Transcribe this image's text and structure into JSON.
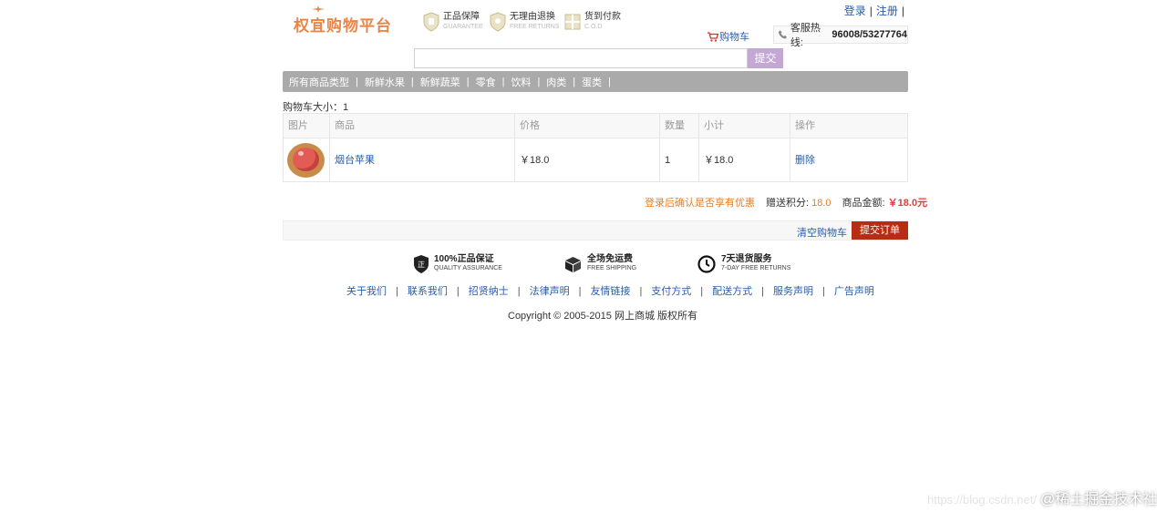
{
  "header": {
    "logo_text": "权宜购物平台",
    "badges": [
      {
        "cn": "正品保障",
        "en": "GUARANTEE"
      },
      {
        "cn": "无理由退换",
        "en": "FREE RETURNS"
      },
      {
        "cn": "货到付款",
        "en": "C.O.D"
      }
    ],
    "login_label": "登录",
    "register_label": "注册",
    "link_sep": "|",
    "cart_label": "购物车",
    "hotline_label": "客服热线:",
    "hotline_number": "96008/53277764"
  },
  "search": {
    "value": "",
    "placeholder": "",
    "button_label": "提交"
  },
  "nav": {
    "items": [
      "所有商品类型",
      "新鲜水果",
      "新鲜蔬菜",
      "零食",
      "饮料",
      "肉类",
      "蛋类"
    ],
    "sep": "|"
  },
  "cart": {
    "size_label": "购物车大小：1",
    "columns": [
      "图片",
      "商品",
      "价格",
      "数量",
      "小计",
      "操作"
    ],
    "rows": [
      {
        "image": "apple-image",
        "product": "烟台苹果",
        "price": "￥18.0",
        "quantity": "1",
        "subtotal": "￥18.0",
        "action": "删除"
      }
    ]
  },
  "summary": {
    "login_hint": "登录后确认是否享有优惠",
    "points_label": "赠送积分:",
    "points_value": "18.0",
    "amount_label": "商品金额:",
    "amount_value": "￥18.0元"
  },
  "actions": {
    "clear_label": "清空购物车",
    "submit_label": "提交订单"
  },
  "promises": [
    {
      "cn": "100%正品保证",
      "en": "QUALITY ASSURANCE",
      "icon": "shield-icon"
    },
    {
      "cn": "全场免运费",
      "en": "FREE SHIPPING",
      "icon": "box-icon"
    },
    {
      "cn": "7天退货服务",
      "en": "7-DAY FREE RETURNS",
      "icon": "clock-icon"
    }
  ],
  "footer": {
    "links": [
      "关于我们",
      "联系我们",
      "招贤纳士",
      "法律声明",
      "友情链接",
      "支付方式",
      "配送方式",
      "服务声明",
      "广告声明"
    ],
    "sep": "|",
    "copyright": "Copyright © 2005-2015 网上商城 版权所有"
  },
  "watermark": {
    "url": "https://blog.csdn.net/",
    "text": "@稀土掘金技术社区"
  },
  "colors": {
    "brand": "#e8864a",
    "link": "#2a5caa",
    "nav_bg": "#aaaaaa",
    "submit": "#b72d13",
    "search_btn": "#c3a8d3",
    "price": "#e4393c",
    "highlight": "#e87e24"
  }
}
